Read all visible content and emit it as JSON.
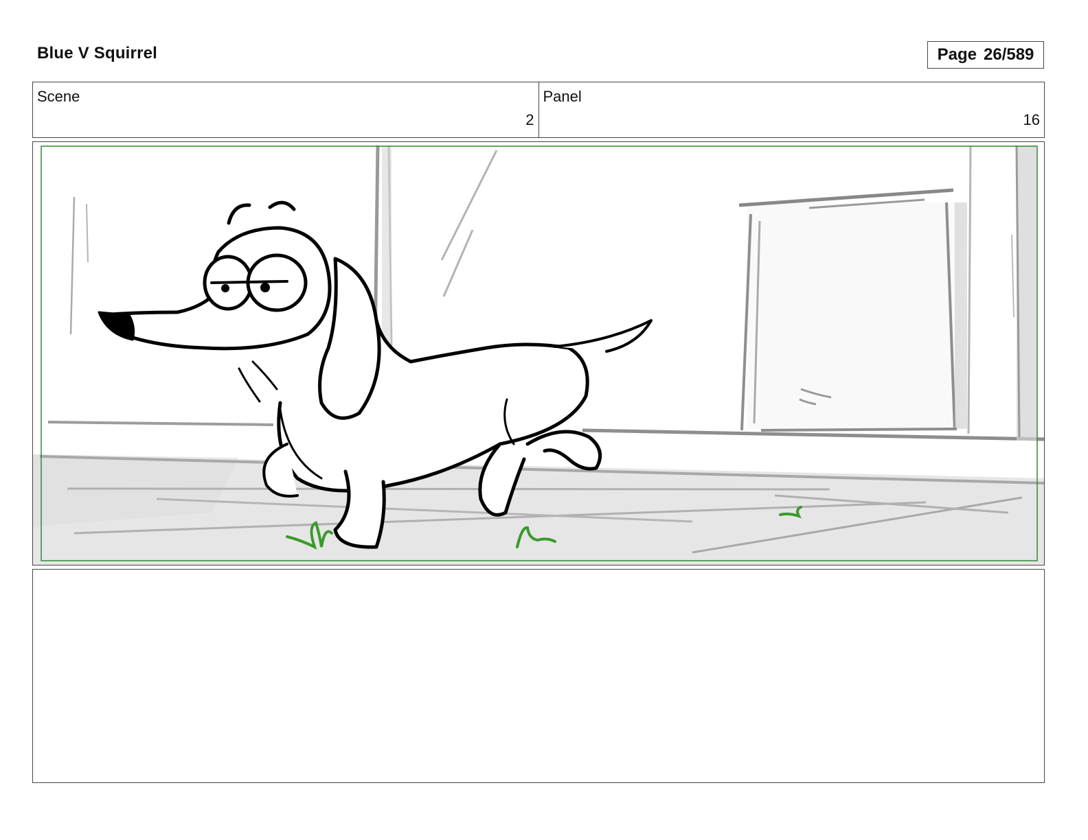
{
  "header": {
    "title": "Blue V Squirrel",
    "page_label": "Page",
    "page_number": "26/589"
  },
  "fields": {
    "scene": {
      "label": "Scene",
      "value": "2"
    },
    "panel": {
      "label": "Panel",
      "value": "16"
    }
  },
  "colors": {
    "border": "#444444",
    "safe_frame": "#2e8b2e",
    "grass": "#3a9a2a",
    "ink": "#000000",
    "background_sketch": "#9a9a9a"
  },
  "notes": {
    "text": ""
  }
}
